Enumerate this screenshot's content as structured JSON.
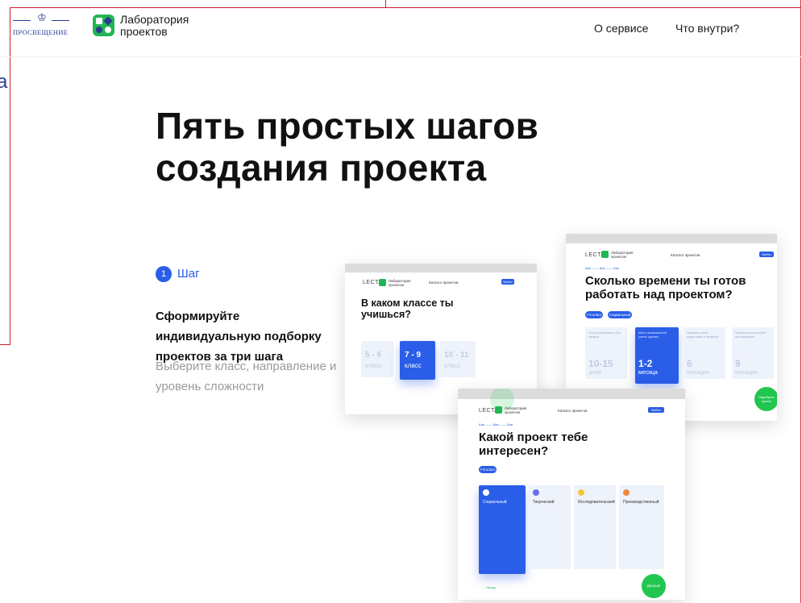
{
  "header": {
    "brand_left": "ПРОСВЕЩЕНИЕ",
    "brand_right": "Лаборатория проектов",
    "nav": [
      "О сервисе",
      "Что внутри?"
    ]
  },
  "edge_letter": "а",
  "hero": {
    "title": "Пять простых шагов создания проекта"
  },
  "step": {
    "number": "1",
    "label": "Шаг",
    "title": "Сформируйте индивидуальную подборку проектов за три шага",
    "description": "Выберите класс, направление и уровень сложности"
  },
  "screen_class": {
    "lecta": "LECTA",
    "lab": "Лаборатория проектов",
    "nav": "Каталог проектов",
    "btn": "Войти",
    "question": "В каком классе ты учишься?",
    "options": [
      {
        "num": "5 - 6",
        "sub": "класс",
        "active": false
      },
      {
        "num": "7 - 9",
        "sub": "класс",
        "active": true
      },
      {
        "num": "10 - 11",
        "sub": "класс",
        "active": false
      }
    ]
  },
  "screen_time": {
    "lecta": "LECTA",
    "lab": "Лаборатория проектов",
    "nav": "Каталог проектов",
    "btn": "Войти",
    "steps": "Шаг —— Шаг —— Шаг",
    "question": "Сколько времени ты готов работать над проектом?",
    "chips": [
      "7-9 класс",
      "Социальный"
    ],
    "options": [
      {
        "hint": "Чтоб организовать сбор средств",
        "num": "10-15",
        "sub": "дней",
        "active": false
      },
      {
        "hint": "Много возможностей успеть сделать",
        "num": "1-2",
        "sub": "месяца",
        "active": true
      },
      {
        "hint": "Написать пьесу, подготовить и провести",
        "num": "6",
        "sub": "месяцев",
        "active": false
      },
      {
        "hint": "Провести многолетнее исследование",
        "num": "9",
        "sub": "месяцев",
        "active": false
      }
    ],
    "go": "Подобрать проект"
  },
  "screen_type": {
    "lecta": "LECTA",
    "lab": "Лаборатория проектов",
    "nav": "Каталог проектов",
    "btn": "Войти",
    "steps": "Шаг —— Шаг —— Шаг",
    "question": "Какой проект тебе интересен?",
    "chip": "7-9 класс",
    "options": [
      {
        "title": "Социальный",
        "active": true,
        "icon_color": "#ffffff"
      },
      {
        "title": "Творческий",
        "active": false,
        "icon_color": "#6b6ee8"
      },
      {
        "title": "Исследовательский",
        "active": false,
        "icon_color": "#f5c542"
      },
      {
        "title": "Производственный",
        "active": false,
        "icon_color": "#f08a3c"
      }
    ],
    "back": "← Назад",
    "next": "Дальше"
  },
  "colors": {
    "accent_blue": "#2a5ee8",
    "accent_green": "#21b655",
    "brand_navy": "#2b3b8f"
  }
}
